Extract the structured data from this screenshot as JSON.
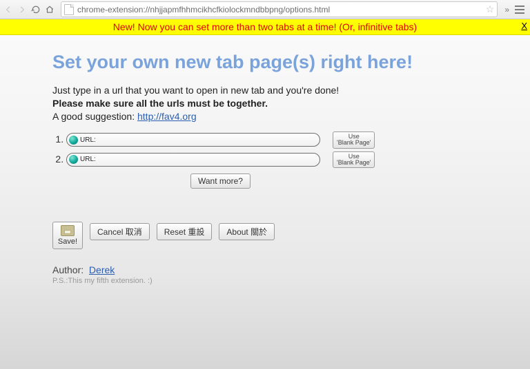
{
  "browser": {
    "url": "chrome-extension://nhjjapmfhhmcikhcfkiolockmndbbpng/options.html"
  },
  "banner": {
    "text": "New! Now you can set more than two tabs at a time! (Or, infinitive tabs)",
    "close": "X"
  },
  "heading": "Set your own new tab page(s) right here!",
  "intro": {
    "line1": "Just type in a url that you want to open in new tab and you're done!",
    "line2": "Please make sure all the urls must be together.",
    "line3_prefix": "A good suggestion: ",
    "suggestion_link": "http://fav4.org"
  },
  "url_rows": {
    "label": "URL:",
    "blank_btn_l1": "Use",
    "blank_btn_l2": "'Blank Page'"
  },
  "buttons": {
    "want_more": "Want more?",
    "save": "Save!",
    "cancel": "Cancel 取消",
    "reset": "Reset 重設",
    "about": "About 關於"
  },
  "footer": {
    "author_label": "Author:",
    "author_name": "Derek",
    "ps": "P.S.:This my fifth extension. :)"
  }
}
